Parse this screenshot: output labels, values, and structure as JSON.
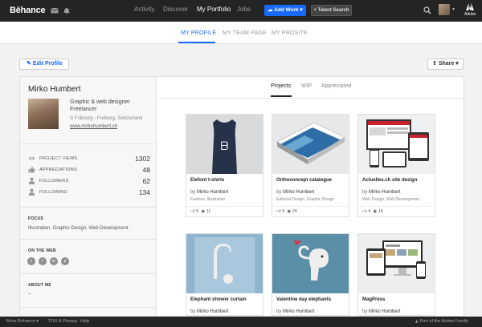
{
  "topbar": {
    "logo": "Bēhance",
    "nav": [
      "Activity",
      "Discover",
      "My Portfolio",
      "Jobs"
    ],
    "add_work": "Add Work",
    "talent_search": "+ Talent Search",
    "adobe": "Adobe"
  },
  "profile_tabs": [
    "MY PROFILE",
    "MY TEAM PAGE",
    "MY PROSITE"
  ],
  "actions": {
    "edit_profile": "Edit Profile",
    "share": "Share"
  },
  "user": {
    "name": "Mirko Humbert",
    "title_line1": "Graphic & web designer",
    "title_line2": "Freelancer",
    "location": "Fribourg - Freiburg, Switzerland",
    "website": "www.mirkohumbert.ch"
  },
  "stats": [
    {
      "label": "PROJECT VIEWS",
      "value": "1302",
      "icon": "eye-icon"
    },
    {
      "label": "APPRECIATIONS",
      "value": "48",
      "icon": "thumbs-up-icon"
    },
    {
      "label": "FOLLOWERS",
      "value": "62",
      "icon": "person-icon"
    },
    {
      "label": "FOLLOWING",
      "value": "134",
      "icon": "person-icon"
    }
  ],
  "focus": {
    "title": "FOCUS",
    "text": "Illustration, Graphic Design, Web Development"
  },
  "on_the_web": {
    "title": "ON THE WEB",
    "icons": [
      "twitter-icon",
      "facebook-icon",
      "linkedin-icon",
      "pinterest-icon"
    ]
  },
  "about": {
    "title": "ABOUT ME",
    "text": "–"
  },
  "content_tabs": [
    "Projects",
    "WIP",
    "Appreciated"
  ],
  "projects": [
    {
      "title": "Elefont t-shirts",
      "by": "by",
      "author": "Mirko Humbert",
      "fields": "Fashion, Illustration",
      "likes": "5",
      "views": "11"
    },
    {
      "title": "Orthoconcept catalogue",
      "by": "by",
      "author": "Mirko Humbert",
      "fields": "Editorial Design, Graphic Design",
      "likes": "5",
      "views": "24"
    },
    {
      "title": "Actuelles.ch site design",
      "by": "by",
      "author": "Mirko Humbert",
      "fields": "Web Design, Web Development",
      "likes": "4",
      "views": "15"
    },
    {
      "title": "Elephant shower curtain",
      "by": "by",
      "author": "Mirko Humbert",
      "fields": "",
      "likes": "",
      "views": ""
    },
    {
      "title": "Valentine day elephants",
      "by": "by",
      "author": "Mirko Humbert",
      "fields": "",
      "likes": "",
      "views": ""
    },
    {
      "title": "MagPress",
      "by": "by",
      "author": "Mirko Humbert",
      "fields": "",
      "likes": "",
      "views": ""
    }
  ],
  "footer": {
    "more_behance": "More Behance",
    "tou": "TOU & Privacy",
    "help": "Help",
    "adobe_family": "Part of the Adobe Family"
  },
  "colors": {
    "accent": "#1769ff",
    "topbar": "#242424"
  }
}
